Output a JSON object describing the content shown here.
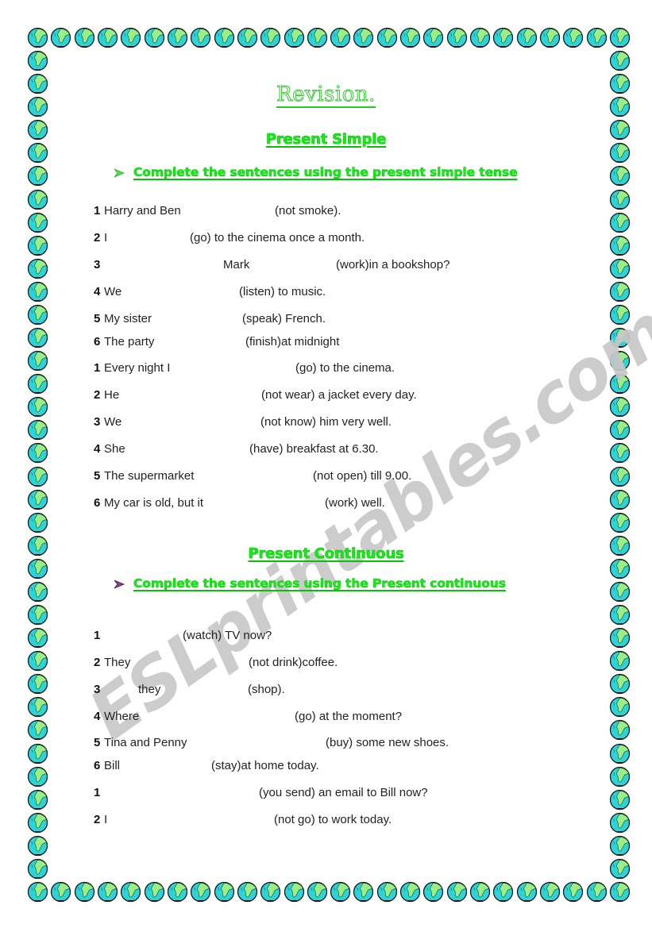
{
  "document": {
    "title": "Revision.",
    "watermark": "ESLprintables.com",
    "colors": {
      "heading_green": "#11ee11",
      "globe_ocean": "#2ad4d8",
      "globe_land": "#99ee88",
      "arrow_green": "#33cc33",
      "arrow_purple": "#662266",
      "body_text": "#222222",
      "watermark_grey": "#c8c8c8"
    },
    "border": {
      "icon": "globe-icon"
    }
  },
  "sections": [
    {
      "heading": "Present Simple",
      "instruction": {
        "icon": "arrow-bullet-icon",
        "text": "Complete the sentences using the present simple tense"
      },
      "groups": [
        {
          "sentences": [
            {
              "num": "1",
              "parts": [
                "Harry and Ben",
                "(not smoke)."
              ]
            },
            {
              "num": "2",
              "parts": [
                "I",
                "(go) to the cinema once a month."
              ]
            },
            {
              "num": "3",
              "parts": [
                "Mark",
                "(work)in a bookshop?"
              ]
            },
            {
              "num": "4",
              "parts": [
                "We",
                "(listen) to music."
              ]
            },
            {
              "num": "5",
              "parts": [
                "My sister",
                "(speak) French."
              ]
            },
            {
              "num": "6",
              "parts": [
                "The party",
                "(finish)at midnight"
              ]
            }
          ]
        },
        {
          "sentences": [
            {
              "num": "1",
              "parts": [
                "Every night I",
                "(go) to the cinema."
              ]
            },
            {
              "num": "2",
              "parts": [
                "He",
                "(not wear) a jacket every day."
              ]
            },
            {
              "num": "3",
              "parts": [
                "We",
                "(not know) him very well."
              ]
            },
            {
              "num": "4",
              "parts": [
                "She",
                "(have) breakfast at 6.30."
              ]
            },
            {
              "num": "5",
              "parts": [
                "The supermarket",
                "(not open) till 9.00."
              ]
            },
            {
              "num": "6",
              "parts": [
                "My car is old, but it",
                "(work) well."
              ]
            }
          ]
        }
      ]
    },
    {
      "heading": "Present Continuous",
      "instruction": {
        "icon": "arrow-bullet-icon",
        "text": "Complete the sentences using the Present continuous"
      },
      "groups": [
        {
          "sentences": [
            {
              "num": "1",
              "parts": [
                "(watch) TV now?"
              ]
            },
            {
              "num": "2",
              "parts": [
                "They",
                "(not drink)coffee."
              ]
            },
            {
              "num": "3",
              "parts": [
                "they",
                "(shop)."
              ]
            },
            {
              "num": "4",
              "parts": [
                "Where",
                "(go) at the moment?"
              ]
            },
            {
              "num": "5",
              "parts": [
                "Tina and Penny",
                "(buy) some new shoes."
              ]
            },
            {
              "num": "6",
              "parts": [
                "Bill",
                "(stay)at home today."
              ]
            },
            {
              "num": "1",
              "parts": [
                "(you send) an email to Bill now?"
              ]
            },
            {
              "num": "2",
              "parts": [
                "I",
                "(not go) to work today."
              ]
            }
          ]
        }
      ]
    }
  ]
}
